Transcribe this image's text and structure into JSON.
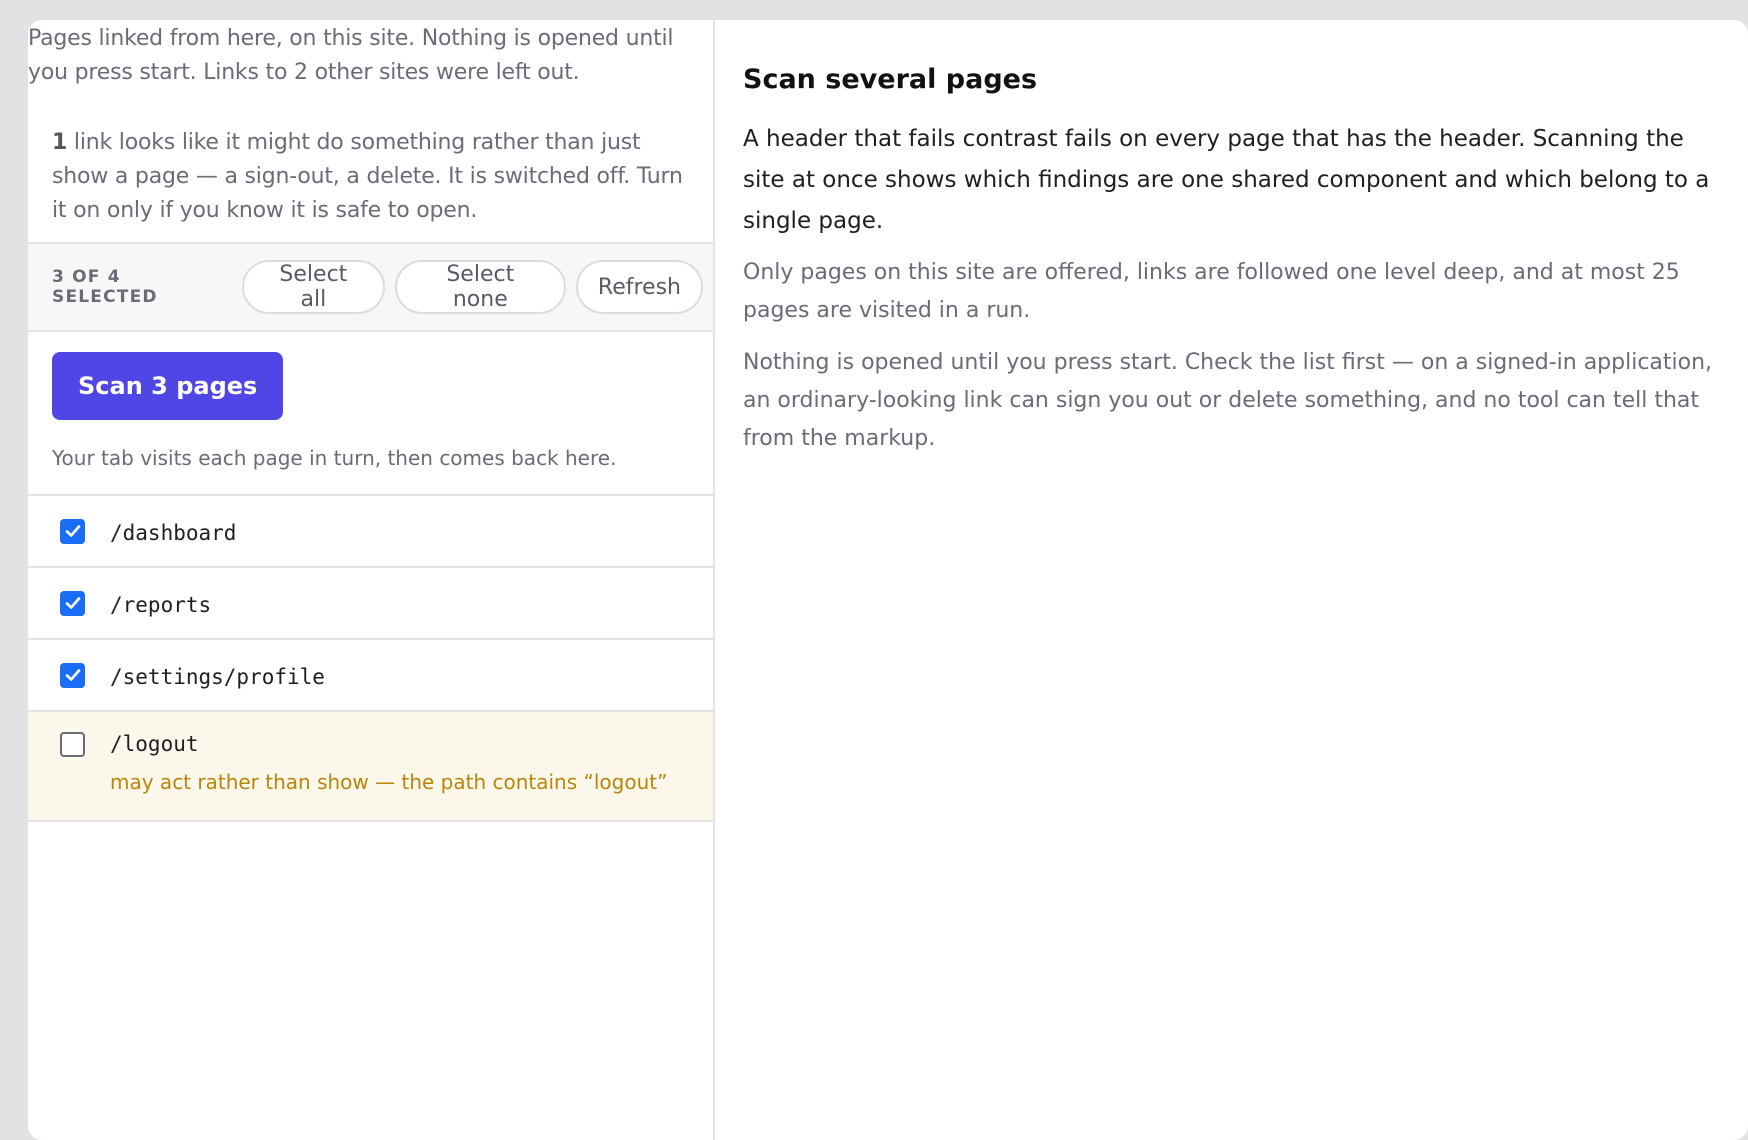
{
  "left": {
    "intro_text": "Pages linked from here, on this site. Nothing is opened until you press start. Links to 2 other sites were left out.",
    "warning": {
      "count": "1",
      "text": " link looks like it might do something rather than just show a page — a sign-out, a delete. It is switched off. Turn it on only if you know it is safe to open."
    },
    "toolbar": {
      "selected_count": "3 OF 4 SELECTED",
      "select_all_label": "Select all",
      "select_none_label": "Select none",
      "refresh_label": "Refresh"
    },
    "scan": {
      "button_label": "Scan 3 pages",
      "help_text": "Your tab visits each page in turn, then comes back here."
    },
    "pages": [
      {
        "path": "/dashboard",
        "checked": true
      },
      {
        "path": "/reports",
        "checked": true
      },
      {
        "path": "/settings/profile",
        "checked": true
      },
      {
        "path": "/logout",
        "checked": false,
        "warning": "may act rather than show — the path contains “logout”"
      }
    ]
  },
  "right": {
    "title": "Scan several pages",
    "paragraph_main": "A header that fails contrast fails on every page that has the header. Scanning the site at once shows which findings are one shared component and which belong to a single page.",
    "paragraph_scope": "Only pages on this site are offered, links are followed one level deep, and at most 25 pages are visited in a run.",
    "paragraph_caution": "Nothing is opened until you press start. Check the list first — on a signed-in application, an ordinary-looking link can sign you out or delete something, and no tool can tell that from the markup."
  },
  "colors": {
    "accent": "#4f46e5",
    "checkbox": "#1a6ef5",
    "warning_text": "#b8860b",
    "warning_bg": "#fbf7ea"
  },
  "icons": [
    "checkmark-icon"
  ]
}
